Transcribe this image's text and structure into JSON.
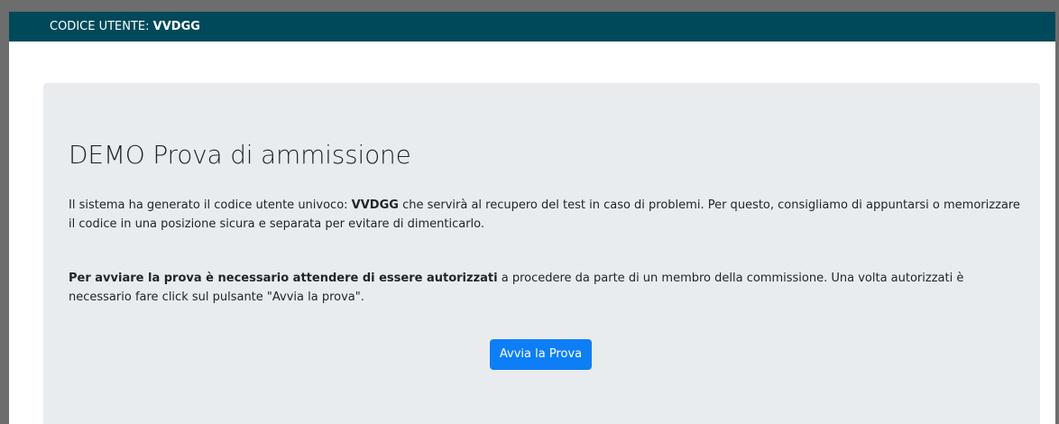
{
  "header": {
    "user_label": "CODICE UTENTE:",
    "user_code": "VVDGG"
  },
  "main": {
    "title": "DEMO Prova di ammissione",
    "paragraph1": {
      "before": "Il sistema ha generato il codice utente univoco: ",
      "code": "VVDGG",
      "after": " che servirà al recupero del test in caso di problemi. Per questo, consigliamo di appuntarsi o memorizzare il codice in una posizione sicura e separata per evitare di dimenticarlo."
    },
    "paragraph2": {
      "bold": "Per avviare la prova è necessario attendere di essere autorizzati",
      "rest": " a procedere da parte di un membro della commissione. Una volta autorizzati è necessario fare click sul pulsante \"Avvia la prova\"."
    },
    "start_button": "Avvia la Prova"
  },
  "colors": {
    "header_bg": "#00495a",
    "panel_bg": "#e9ecef",
    "button_bg": "#0d7ef6",
    "frame": "#6d6d6d"
  }
}
